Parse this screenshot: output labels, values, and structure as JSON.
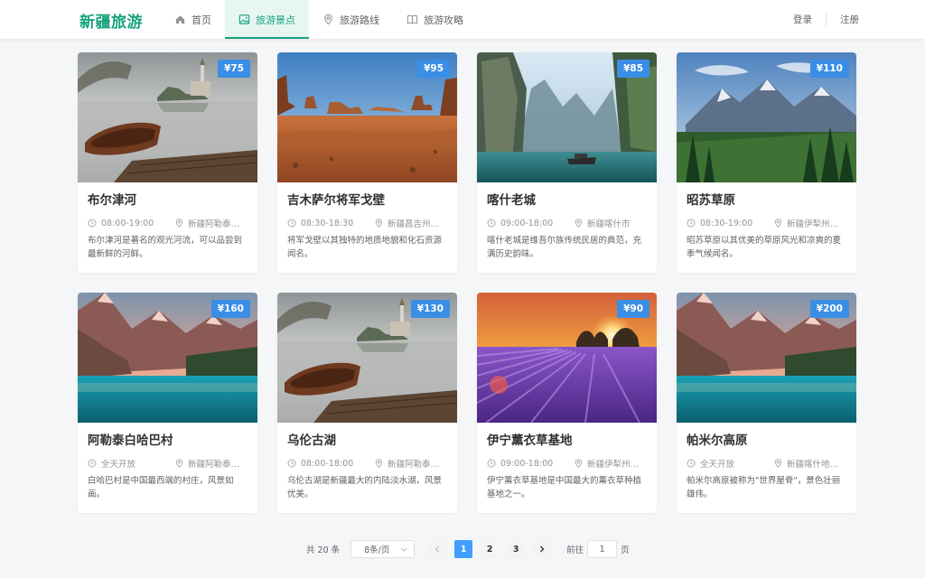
{
  "brand": "新疆旅游",
  "nav": [
    {
      "label": "首页",
      "icon": "home-icon",
      "active": false
    },
    {
      "label": "旅游景点",
      "icon": "image-icon",
      "active": true
    },
    {
      "label": "旅游路线",
      "icon": "location-icon",
      "active": false
    },
    {
      "label": "旅游攻略",
      "icon": "book-icon",
      "active": false
    }
  ],
  "auth": {
    "login": "登录",
    "register": "注册"
  },
  "cards": [
    {
      "title": "布尔津河",
      "price": "¥75",
      "hours": "08:00-19:00",
      "location": "新疆阿勒泰地区布尔津县",
      "desc": "布尔津河是著名的观光河流，可以品尝到最新鲜的河鲜。",
      "image": "lake-boat"
    },
    {
      "title": "吉木萨尔将军戈壁",
      "price": "¥95",
      "hours": "08:30-18:30",
      "location": "新疆昌吉州吉木萨尔县",
      "desc": "将军戈壁以其独特的地质地貌和化石资源闻名。",
      "image": "desert-canyon"
    },
    {
      "title": "喀什老城",
      "price": "¥85",
      "hours": "09:00-18:00",
      "location": "新疆喀什市",
      "desc": "喀什老城是维吾尔族传统民居的典范，充满历史韵味。",
      "image": "river-cliffs"
    },
    {
      "title": "昭苏草原",
      "price": "¥110",
      "hours": "08:30-19:00",
      "location": "新疆伊犁州昭苏县",
      "desc": "昭苏草原以其优美的草原风光和凉爽的夏季气候闻名。",
      "image": "mountain-forest"
    },
    {
      "title": "阿勒泰白哈巴村",
      "price": "¥160",
      "hours": "全天开放",
      "location": "新疆阿勒泰地区哈巴河县",
      "desc": "白哈巴村是中国最西端的村庄，风景如画。",
      "image": "mountain-lake"
    },
    {
      "title": "乌伦古湖",
      "price": "¥130",
      "hours": "08:00-18:00",
      "location": "新疆阿勒泰地区福海县",
      "desc": "乌伦古湖是新疆最大的内陆淡水湖，风景优美。",
      "image": "lake-boat"
    },
    {
      "title": "伊宁薰衣草基地",
      "price": "¥90",
      "hours": "09:00-18:00",
      "location": "新疆伊犁州伊宁县",
      "desc": "伊宁薰衣草基地是中国最大的薰衣草种植基地之一。",
      "image": "lavender-sunset"
    },
    {
      "title": "帕米尔高原",
      "price": "¥200",
      "hours": "全天开放",
      "location": "新疆喀什地区塔什库尔干县",
      "desc": "帕米尔高原被称为\"世界屋脊\"，景色壮丽雄伟。",
      "image": "mountain-lake"
    }
  ],
  "pagination": {
    "total": "共 20 条",
    "page_size": "8条/页",
    "pages": [
      "1",
      "2",
      "3"
    ],
    "current": 1,
    "goto_prefix": "前往",
    "goto_value": "1",
    "goto_suffix": "页"
  },
  "colors": {
    "brand": "#16a27e",
    "price_badge": "#3a8ee6",
    "page_active": "#409eff"
  }
}
